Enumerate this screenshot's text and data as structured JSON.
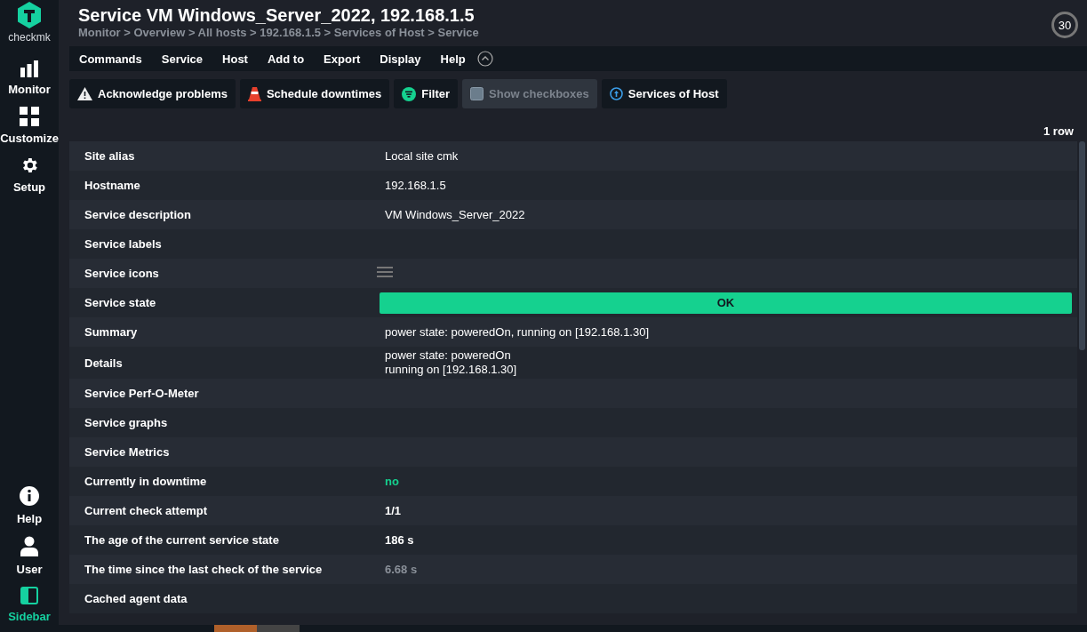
{
  "logo": {
    "text": "checkmk"
  },
  "nav_top": [
    {
      "label": "Monitor"
    },
    {
      "label": "Customize"
    },
    {
      "label": "Setup"
    }
  ],
  "nav_bottom": [
    {
      "label": "Help",
      "selected": false
    },
    {
      "label": "User",
      "selected": false
    },
    {
      "label": "Sidebar",
      "selected": true
    }
  ],
  "title": "Service VM Windows_Server_2022, 192.168.1.5",
  "breadcrumb": "Monitor > Overview > All hosts > 192.168.1.5 > Services of Host > Service",
  "refresh": "30",
  "menu": [
    "Commands",
    "Service",
    "Host",
    "Add to",
    "Export",
    "Display",
    "Help"
  ],
  "actions": [
    {
      "label": "Acknowledge problems",
      "disabled": false
    },
    {
      "label": "Schedule downtimes",
      "disabled": false
    },
    {
      "label": "Filter",
      "disabled": false
    },
    {
      "label": "Show checkboxes",
      "disabled": true
    },
    {
      "label": "Services of Host",
      "disabled": false
    }
  ],
  "row_count": "1 row",
  "rows": [
    {
      "label": "Site alias",
      "kind": "plain",
      "value": "Local site cmk"
    },
    {
      "label": "Hostname",
      "kind": "plain",
      "value": "192.168.1.5"
    },
    {
      "label": "Service description",
      "kind": "plain",
      "value": "VM Windows_Server_2022"
    },
    {
      "label": "Service labels",
      "kind": "empty"
    },
    {
      "label": "Service icons",
      "kind": "icons"
    },
    {
      "label": "Service state",
      "kind": "state",
      "value": "OK"
    },
    {
      "label": "Summary",
      "kind": "plain",
      "value": "power state: poweredOn, running on [192.168.1.30]"
    },
    {
      "label": "Details",
      "kind": "lines",
      "lines": [
        "power state: poweredOn",
        "running on [192.168.1.30]"
      ]
    },
    {
      "label": "Service Perf-O-Meter",
      "kind": "empty"
    },
    {
      "label": "Service graphs",
      "kind": "empty"
    },
    {
      "label": "Service Metrics",
      "kind": "empty"
    },
    {
      "label": "Currently in downtime",
      "kind": "green",
      "value": "no"
    },
    {
      "label": "Current check attempt",
      "kind": "bold",
      "value": "1/1"
    },
    {
      "label": "The age of the current service state",
      "kind": "bold",
      "value": "186 s"
    },
    {
      "label": "The time since the last check of the service",
      "kind": "muted",
      "value": "6.68 s"
    },
    {
      "label": "Cached agent data",
      "kind": "empty"
    }
  ]
}
